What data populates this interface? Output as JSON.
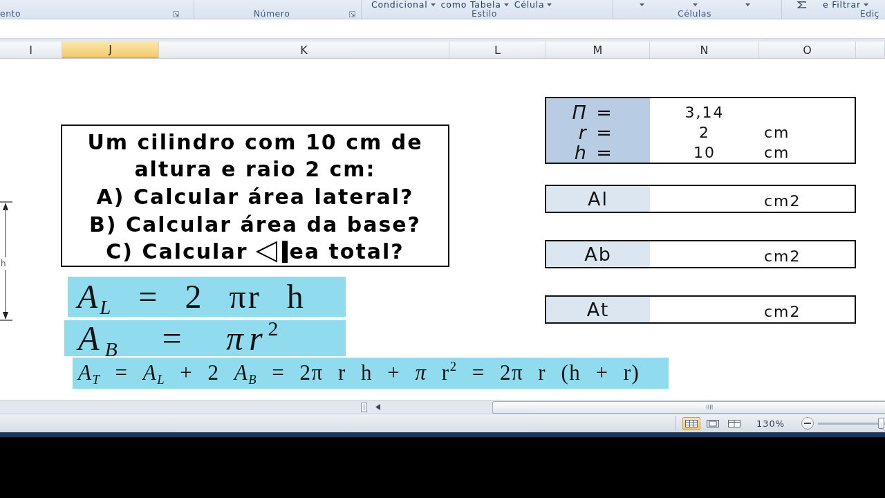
{
  "ribbon": {
    "groups": [
      {
        "label": "ento",
        "launcher": true
      },
      {
        "label": "Número",
        "launcher": true
      },
      {
        "label": "Estilo",
        "launcher": false,
        "items": [
          {
            "kind": "menu",
            "label": "Condicional"
          },
          {
            "kind": "menu",
            "label": "como Tabela"
          },
          {
            "kind": "menu",
            "label": "Célula"
          }
        ]
      },
      {
        "label": "Células",
        "launcher": false,
        "items": [
          {
            "kind": "caret"
          },
          {
            "kind": "caret"
          },
          {
            "kind": "caret"
          }
        ]
      },
      {
        "label": "Ediç",
        "launcher": false,
        "items": [
          {
            "kind": "sum"
          },
          {
            "kind": "menu",
            "label": "e Filtrar"
          }
        ]
      }
    ]
  },
  "columns": [
    {
      "label": "I",
      "selected": false
    },
    {
      "label": "J",
      "selected": true
    },
    {
      "label": "K",
      "selected": false
    },
    {
      "label": "L",
      "selected": false
    },
    {
      "label": "M",
      "selected": false
    },
    {
      "label": "N",
      "selected": false
    },
    {
      "label": "O",
      "selected": false
    }
  ],
  "diagram": {
    "label": "h"
  },
  "question": {
    "lines": [
      {
        "parts": [
          "Um cilindro com 10 cm de"
        ],
        "cursor": false
      },
      {
        "parts": [
          "altura e raio 2 cm:"
        ],
        "cursor": false
      },
      {
        "parts": [
          "A) Calcular área lateral?"
        ],
        "cursor": false
      },
      {
        "parts": [
          "B) Calcular área da base?"
        ],
        "cursor": false
      },
      {
        "parts": [
          "C) Calcular",
          "ea total?"
        ],
        "cursor": true
      }
    ]
  },
  "formulas": [
    "*A*$_{L}$ = 2 πr h",
    "*A*$_{B}$ = *πr*$^{2}$",
    "*A*$_{T}$ = *A*$_{L}$ + 2 *A*$_{B}$ = 2π r h + *π* r$^{2}$ = 2π r (h + r)"
  ],
  "parameters": [
    {
      "symbol": "Π =",
      "value": "3,14"
    },
    {
      "symbol": "r =",
      "value": "2",
      "unit": "cm"
    },
    {
      "symbol": "h =",
      "value": "10",
      "unit": "cm"
    }
  ],
  "results": [
    {
      "label": "Al",
      "unit": "cm2"
    },
    {
      "label": "Ab",
      "unit": "cm2"
    },
    {
      "label": "At",
      "unit": "cm2"
    }
  ],
  "status_bar": {
    "views": [
      {
        "kind": "normal",
        "selected": true
      },
      {
        "kind": "page_layout",
        "selected": false
      },
      {
        "kind": "page_break",
        "selected": false
      }
    ],
    "zoom": "130%",
    "zoom_slider": {
      "level": 0.95
    }
  }
}
